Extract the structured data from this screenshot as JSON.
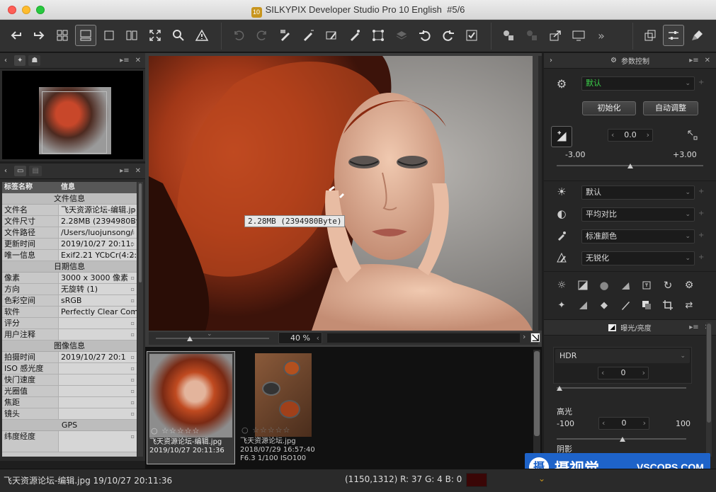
{
  "window": {
    "title": "SILKYPIX Developer Studio Pro 10 English",
    "counter": "#5/6",
    "app_icon_text": "10"
  },
  "toolbar": {
    "icons": [
      "undo-left-icon",
      "redo-right-icon",
      "grid-view-icon",
      "preview-thumb-icon",
      "single-view-icon",
      "compare-view-icon",
      "fullscreen-icon",
      "zoom-icon",
      "warning-icon",
      "undo-icon",
      "redo-icon",
      "brush-tool-icon",
      "pen-tool-icon",
      "eraser-tool-icon",
      "spot-tool-icon",
      "crop-tool-icon",
      "layers-icon",
      "rotate-left-icon",
      "rotate-right-icon",
      "check-icon",
      "develop-icon",
      "batch-icon",
      "export-icon",
      "monitor-icon",
      "more-icon",
      "window-icon",
      "adjust-icon",
      "clean-icon"
    ]
  },
  "navigator": {
    "tabs": [
      "pin-tab",
      "cat-tab"
    ]
  },
  "info_panel": {
    "col_key": "标签名称",
    "col_value": "信息",
    "sections": [
      {
        "title": "文件信息",
        "rows": [
          {
            "k": "文件名",
            "v": "飞天资源论坛-编辑.jp"
          },
          {
            "k": "文件尺寸",
            "v": "2.28MB (2394980Byt"
          },
          {
            "k": "文件路径",
            "v": "/Users/luojunsong/"
          },
          {
            "k": "更新时间",
            "v": "2019/10/27 20:11:"
          },
          {
            "k": "唯一信息",
            "v": "Exif2.21 YCbCr(4:2:"
          }
        ]
      },
      {
        "title": "日期信息",
        "rows": [
          {
            "k": "像素",
            "v": "3000 x 3000 像素"
          },
          {
            "k": "方向",
            "v": "无旋转 (1)"
          },
          {
            "k": "色彩空间",
            "v": "sRGB"
          },
          {
            "k": "软件",
            "v": "Perfectly Clear Com"
          },
          {
            "k": "评分",
            "v": ""
          },
          {
            "k": "用户注释",
            "v": ""
          }
        ]
      },
      {
        "title": "图像信息",
        "rows": [
          {
            "k": "拍摄时间",
            "v": "2019/10/27 20:1"
          },
          {
            "k": "ISO 感光度",
            "v": ""
          },
          {
            "k": "快门速度",
            "v": ""
          },
          {
            "k": "光圈值",
            "v": ""
          },
          {
            "k": "焦距",
            "v": ""
          },
          {
            "k": "镜头",
            "v": ""
          }
        ]
      },
      {
        "title": "GPS",
        "rows": [
          {
            "k": "纬度经度",
            "v": ""
          }
        ]
      }
    ]
  },
  "preview": {
    "tooltip": "2.28MB (2394980Byte)",
    "zoom": "40 %"
  },
  "filmstrip": [
    {
      "name": "飞天资源论坛-编辑.jpg",
      "date": "2019/10/27 20:11:36",
      "extra": "",
      "selected": true
    },
    {
      "name": "飞天资源论坛.jpg",
      "date": "2018/07/29 16:57:40",
      "extra": "F6.3 1/100 ISO100",
      "selected": false
    }
  ],
  "params": {
    "title": "参数控制",
    "preset": "默认",
    "init_button": "初始化",
    "auto_button": "自动调整",
    "exposure_value": "0.0",
    "exposure_min": "-3.00",
    "exposure_max": "+3.00",
    "exposure_level": 0.5,
    "white_balance": "默认",
    "contrast": "平均对比",
    "color": "标准颜色",
    "sharpness": "无锐化"
  },
  "exposure_panel": {
    "title": "曝光/亮度",
    "mode": "HDR",
    "hdr_value": "0",
    "highlight_label": "高光",
    "highlight_value": "0",
    "highlight_min": "-100",
    "highlight_max": "100",
    "shadow_label": "阴影"
  },
  "status": {
    "file": "飞天资源论坛-编辑.jpg 19/10/27 20:11:36",
    "pixel": "(1150,1312) R: 37 G:  4 B:  0",
    "swatch_color": "#3a0606"
  },
  "watermark": {
    "text": "摄视觉",
    "site": "VSCOPS.COM"
  }
}
